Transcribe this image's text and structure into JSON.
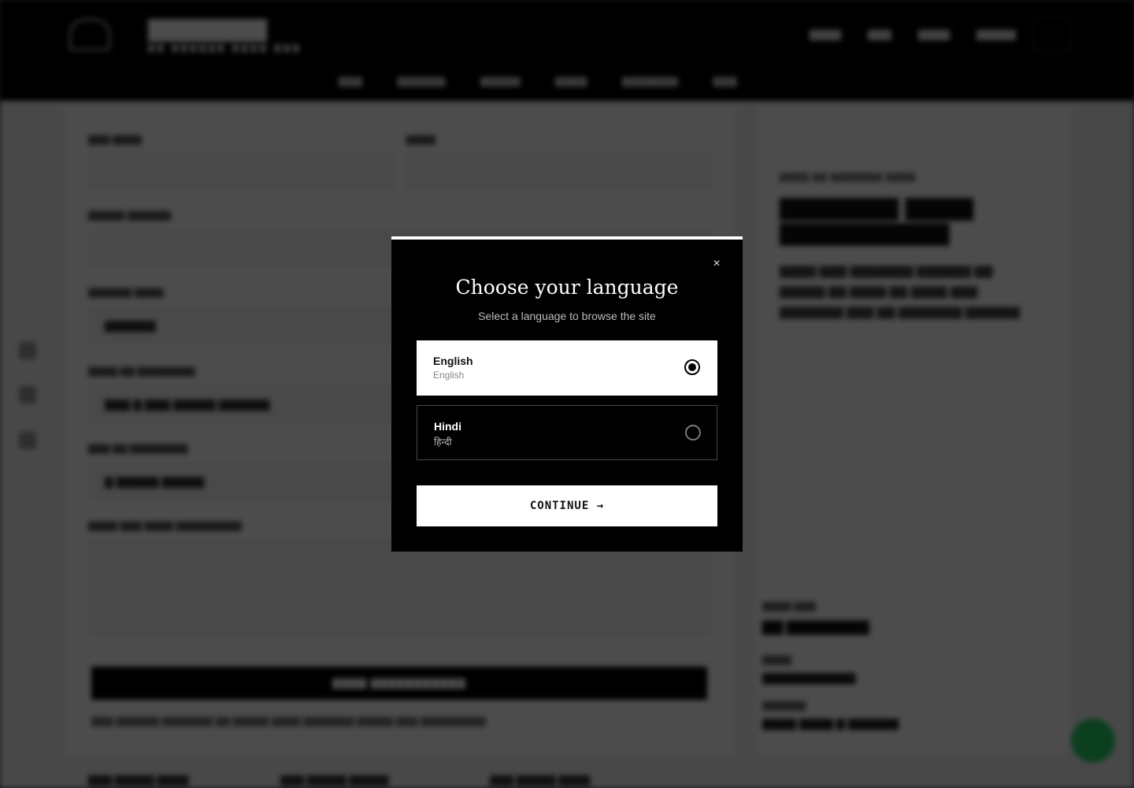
{
  "modal": {
    "title": "Choose your language",
    "subtitle": "Select a language to browse the site",
    "close_label": "×",
    "languages": [
      {
        "name": "English",
        "native": "English",
        "selected": true
      },
      {
        "name": "Hindi",
        "native": "हिन्दी",
        "selected": false
      }
    ],
    "continue_label": "CONTINUE →"
  },
  "colors": {
    "modal_bg": "#000000",
    "selected_bg": "#ffffff",
    "overlay": "rgba(0,0,0,0.7)",
    "chat_fab": "#25d366"
  },
  "icons": [
    "close-icon",
    "radio-selected-icon",
    "radio-unselected-icon",
    "chat-icon"
  ]
}
